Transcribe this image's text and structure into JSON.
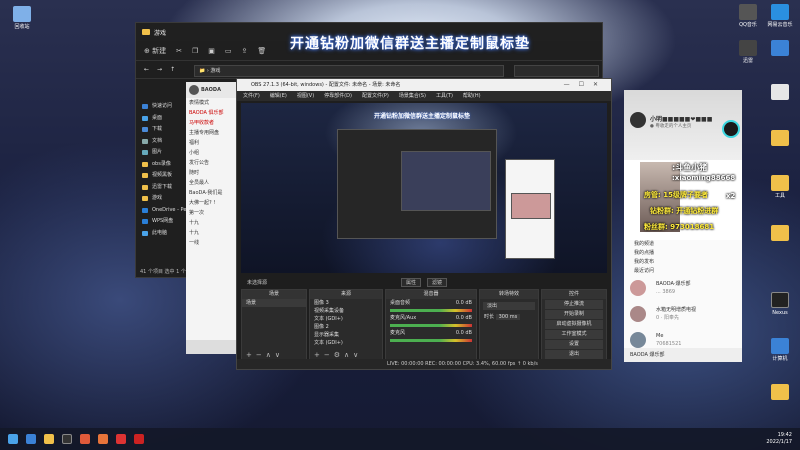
{
  "banner": "开通钻粉加微信群送主播定制鼠标垫",
  "explorer": {
    "title": "游戏",
    "new_label": "新建",
    "address": "游戏",
    "sidebar": [
      "快速访问",
      "桌面",
      "下载",
      "文档",
      "图片",
      "obs录像",
      "视频黑板",
      "迅雷下载",
      "游戏",
      "OneDrive - Person",
      "WPS网盘",
      "此电脑"
    ],
    "status": "41 个项目  选中 1 个项目"
  },
  "chat": {
    "header": "BAODA",
    "items": [
      "表情模式",
      "BAODA 俱乐部",
      "马甲收款者",
      "主播专用网盘",
      "福利",
      "小组",
      "发行公告",
      "随时",
      "全员最人",
      "BaoDA·我们是",
      "大佛一起? !",
      "第一次",
      "十九",
      "十九",
      "一线"
    ]
  },
  "obs": {
    "title": "OBS 27.1.3 (64-bit, windows) - 配置文件: 未命名 - 场景: 未命名",
    "menu": [
      "文件(F)",
      "编辑(E)",
      "视图(V)",
      "停靠部件(D)",
      "配置文件(P)",
      "场景集合(S)",
      "工具(T)",
      "帮助(H)"
    ],
    "preview_banner": "开通钻粉加微信群送主播定制鼠标垫",
    "toolbar": [
      "属性",
      "滤镜"
    ],
    "toolbar_source_label": "未选择源",
    "docks": {
      "scenes": {
        "title": "场景",
        "items": [
          "场景"
        ]
      },
      "sources": {
        "title": "来源",
        "items": [
          "图像 3",
          "视频采集设备",
          "文本 (GDI+)",
          "图像 2",
          "显示器采集",
          "文本 (GDI+)",
          "图像",
          "窗口采集",
          "游戏"
        ]
      },
      "mixer": {
        "title": "混音器",
        "tracks": [
          {
            "name": "桌面音频",
            "db": "0.0 dB"
          },
          {
            "name": "麦克风/Aux",
            "db": "0.0 dB"
          },
          {
            "name": "麦克风",
            "db": "0.0 dB"
          }
        ]
      },
      "transitions": {
        "title": "转场特效",
        "type": "淡出",
        "duration_label": "时长",
        "duration": "300 ms"
      },
      "controls": {
        "title": "控件",
        "buttons": [
          "停止推流",
          "开始录制",
          "启动虚拟摄像机",
          "工作室模式",
          "设置",
          "退出"
        ]
      }
    },
    "status": "LIVE: 00:00:00   REC: 00:00:00   CPU: 3.4%, 60.00 fps   ↑ 0 kb/s"
  },
  "stream": {
    "name": "小明■■■■■❤■■■",
    "sub": "● 粤收走的个人主页",
    "promo_lines": [
      ":斗鱼小猪",
      ":xiaoming88668",
      "房管: 15级牌子要者",
      "钻粉群: 开通钻粉进群",
      "粉丝群: 973018681"
    ],
    "promo_badge": "x2",
    "list": [
      "我的频道",
      "我的点播",
      "我的发布",
      "最近访问"
    ],
    "items": [
      {
        "name": "BAODA·爆乐部",
        "meta": "... 3869"
      },
      {
        "name": "水箱无明增质电视",
        "meta": "0 · 阳奉先"
      },
      {
        "name": "Me",
        "meta": "70681521"
      }
    ],
    "footer": "BAODA 爆乐部"
  },
  "desktop_icons": [
    "回收站",
    "QQ音乐",
    "网易云音乐",
    "迅雷",
    "Nexus",
    "工具",
    "WPS",
    "计算机"
  ],
  "taskbar": {
    "time": "19:42",
    "date": "2022/1/17"
  }
}
